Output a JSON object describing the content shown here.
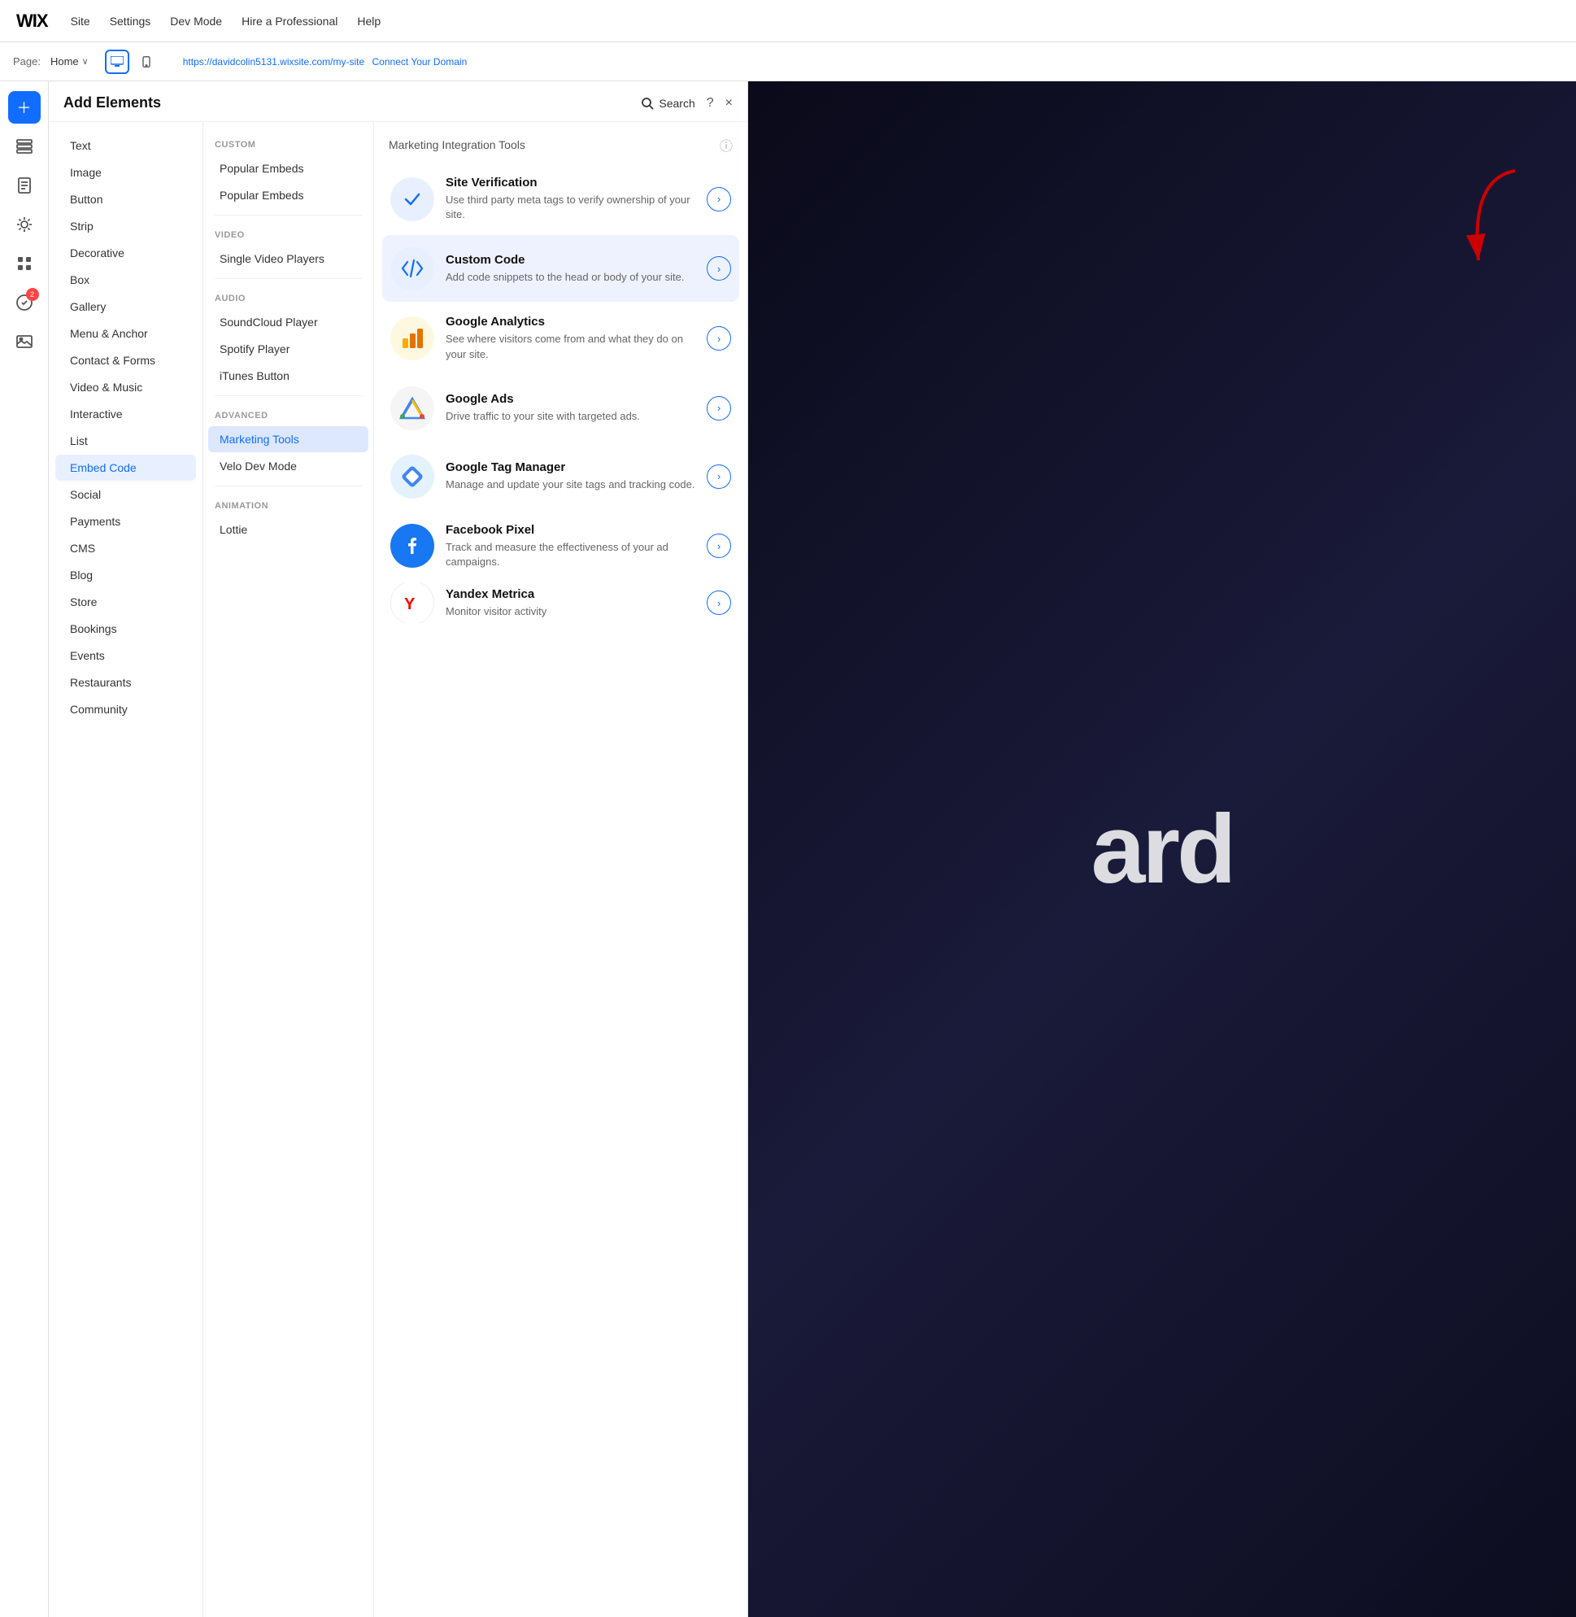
{
  "topNav": {
    "logo": "WIX",
    "links": [
      "Site",
      "Settings",
      "Dev Mode",
      "Hire a Professional",
      "Help"
    ]
  },
  "pageBar": {
    "pageLabel": "Page:",
    "pageName": "Home",
    "url": "https://davidcolin5131.wixsite.com/my-site",
    "connectDomain": "Connect Your Domain"
  },
  "addElementsPanel": {
    "title": "Add Elements",
    "searchLabel": "Search",
    "helpLabel": "?",
    "closeLabel": "×"
  },
  "categories": [
    {
      "id": "text",
      "label": "Text"
    },
    {
      "id": "image",
      "label": "Image"
    },
    {
      "id": "button",
      "label": "Button"
    },
    {
      "id": "strip",
      "label": "Strip"
    },
    {
      "id": "decorative",
      "label": "Decorative"
    },
    {
      "id": "box",
      "label": "Box"
    },
    {
      "id": "gallery",
      "label": "Gallery"
    },
    {
      "id": "menu-anchor",
      "label": "Menu & Anchor"
    },
    {
      "id": "contact-forms",
      "label": "Contact & Forms"
    },
    {
      "id": "video-music",
      "label": "Video & Music"
    },
    {
      "id": "interactive",
      "label": "Interactive"
    },
    {
      "id": "list",
      "label": "List"
    },
    {
      "id": "embed-code",
      "label": "Embed Code",
      "active": true
    },
    {
      "id": "social",
      "label": "Social"
    },
    {
      "id": "payments",
      "label": "Payments"
    },
    {
      "id": "cms",
      "label": "CMS"
    },
    {
      "id": "blog",
      "label": "Blog"
    },
    {
      "id": "store",
      "label": "Store"
    },
    {
      "id": "bookings",
      "label": "Bookings"
    },
    {
      "id": "events",
      "label": "Events"
    },
    {
      "id": "restaurants",
      "label": "Restaurants"
    },
    {
      "id": "community",
      "label": "Community"
    }
  ],
  "subSections": [
    {
      "label": "CUSTOM",
      "items": [
        {
          "id": "popular-embeds-1",
          "label": "Popular Embeds"
        },
        {
          "id": "popular-embeds-2",
          "label": "Popular Embeds"
        }
      ]
    },
    {
      "label": "VIDEO",
      "items": [
        {
          "id": "single-video",
          "label": "Single Video Players"
        }
      ]
    },
    {
      "label": "AUDIO",
      "items": [
        {
          "id": "soundcloud",
          "label": "SoundCloud Player"
        },
        {
          "id": "spotify",
          "label": "Spotify Player"
        },
        {
          "id": "itunes",
          "label": "iTunes Button"
        }
      ]
    },
    {
      "label": "ADVANCED",
      "items": [
        {
          "id": "marketing-tools",
          "label": "Marketing Tools",
          "active": true
        },
        {
          "id": "velo-dev-mode",
          "label": "Velo Dev Mode"
        }
      ]
    },
    {
      "label": "ANIMATION",
      "items": [
        {
          "id": "lottie",
          "label": "Lottie"
        }
      ]
    }
  ],
  "toolsSection": {
    "title": "Marketing Integration Tools",
    "tools": [
      {
        "id": "site-verification",
        "name": "Site Verification",
        "desc": "Use third party meta tags to verify ownership of your site.",
        "iconType": "checkmark",
        "iconBg": "#e8f0ff"
      },
      {
        "id": "custom-code",
        "name": "Custom Code",
        "desc": "Add code snippets to the head or body of your site.",
        "iconType": "code",
        "iconBg": "#e8f0ff",
        "highlighted": true
      },
      {
        "id": "google-analytics",
        "name": "Google Analytics",
        "desc": "See where visitors come from and what they do on your site.",
        "iconType": "analytics",
        "iconBg": "#fff3e0"
      },
      {
        "id": "google-ads",
        "name": "Google Ads",
        "desc": "Drive traffic to your site with targeted ads.",
        "iconType": "ads",
        "iconBg": "#e8f5e9"
      },
      {
        "id": "google-tag-manager",
        "name": "Google Tag Manager",
        "desc": "Manage and update your site tags and tracking code.",
        "iconType": "tag",
        "iconBg": "#e3f2fd"
      },
      {
        "id": "facebook-pixel",
        "name": "Facebook Pixel",
        "desc": "Track and measure the effectiveness of your ad campaigns.",
        "iconType": "facebook",
        "iconBg": "#1877F2"
      },
      {
        "id": "yandex-metrica",
        "name": "Yandex Metrica",
        "desc": "Monitor visitor activity",
        "iconType": "yandex",
        "iconBg": "#fff"
      }
    ]
  },
  "canvasText": "ard",
  "iconSidebar": [
    {
      "id": "plus",
      "symbol": "+",
      "active": true
    },
    {
      "id": "layers",
      "symbol": "☰"
    },
    {
      "id": "pages",
      "symbol": "📄"
    },
    {
      "id": "theme",
      "symbol": "🎨"
    },
    {
      "id": "apps",
      "symbol": "⊞"
    },
    {
      "id": "marketplace",
      "symbol": "⚙",
      "badge": "2"
    },
    {
      "id": "media",
      "symbol": "🖼"
    }
  ]
}
